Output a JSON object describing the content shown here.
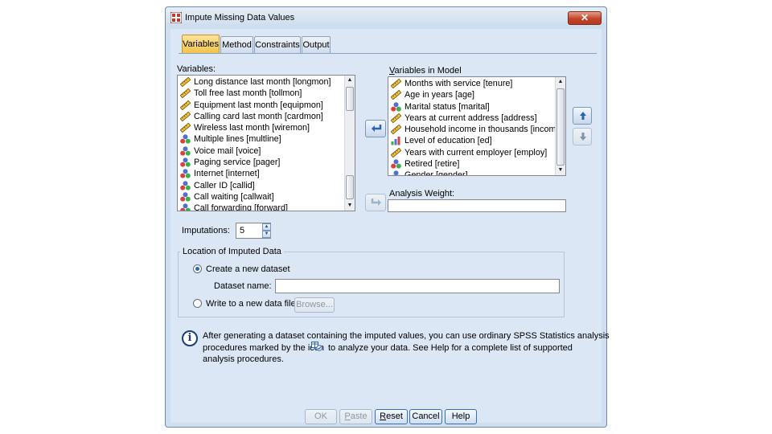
{
  "window": {
    "title": "Impute Missing Data Values",
    "close": "✕"
  },
  "tabs": [
    {
      "label": "Variables",
      "active": true
    },
    {
      "label": "Method",
      "active": false
    },
    {
      "label": "Constraints",
      "active": false
    },
    {
      "label": "Output",
      "active": false
    }
  ],
  "variables_label": "Variables:",
  "variables": [
    {
      "label": "Long distance last month [longmon]",
      "icon": "scale-icon"
    },
    {
      "label": "Toll free last month [tollmon]",
      "icon": "scale-icon"
    },
    {
      "label": "Equipment last month [equipmon]",
      "icon": "scale-icon"
    },
    {
      "label": "Calling card last month [cardmon]",
      "icon": "scale-icon"
    },
    {
      "label": "Wireless last month [wiremon]",
      "icon": "scale-icon"
    },
    {
      "label": "Multiple lines [multline]",
      "icon": "nominal-icon"
    },
    {
      "label": "Voice mail [voice]",
      "icon": "nominal-icon"
    },
    {
      "label": "Paging service [pager]",
      "icon": "nominal-icon"
    },
    {
      "label": "Internet [internet]",
      "icon": "nominal-icon"
    },
    {
      "label": "Caller ID [callid]",
      "icon": "nominal-icon"
    },
    {
      "label": "Call waiting [callwait]",
      "icon": "nominal-icon"
    },
    {
      "label": "Call forwarding [forward]",
      "icon": "nominal-icon"
    }
  ],
  "model_label": "Variables in Model",
  "model_variables": [
    {
      "label": "Months with service [tenure]",
      "icon": "scale-icon"
    },
    {
      "label": "Age in years [age]",
      "icon": "scale-icon"
    },
    {
      "label": "Marital status [marital]",
      "icon": "nominal-icon"
    },
    {
      "label": "Years at current address [address]",
      "icon": "scale-icon"
    },
    {
      "label": "Household income in thousands [income]",
      "icon": "scale-icon"
    },
    {
      "label": "Level of education [ed]",
      "icon": "ordinal-icon"
    },
    {
      "label": "Years with current employer [employ]",
      "icon": "scale-icon"
    },
    {
      "label": "Retired [retire]",
      "icon": "nominal-icon"
    },
    {
      "label": "Gender [gender]",
      "icon": "nominal-icon"
    }
  ],
  "analysis_weight_label": "Analysis Weight:",
  "imputations_label": "Imputations:",
  "imputations_value": "5",
  "location_group_title": "Location of Imputed Data",
  "create_dataset_label": "Create a new dataset",
  "dataset_name_label": "Dataset name:",
  "write_file_label": "Write to a new data file",
  "browse_label": "Browse...",
  "info": {
    "line1": "After generating a dataset containing the imputed values, you can use ordinary SPSS Statistics analysis",
    "line2a": "procedures marked by the icon",
    "line2b": "to analyze your data. See Help for a complete list of supported",
    "line3": "analysis procedures."
  },
  "buttons": {
    "ok": "OK",
    "paste": "Paste",
    "reset": "Reset",
    "cancel": "Cancel",
    "help": "Help"
  },
  "colors": {
    "active_tab": "#f2c54a",
    "window_bg": "#dce7f5",
    "arrow_blue": "#2a64b2"
  }
}
